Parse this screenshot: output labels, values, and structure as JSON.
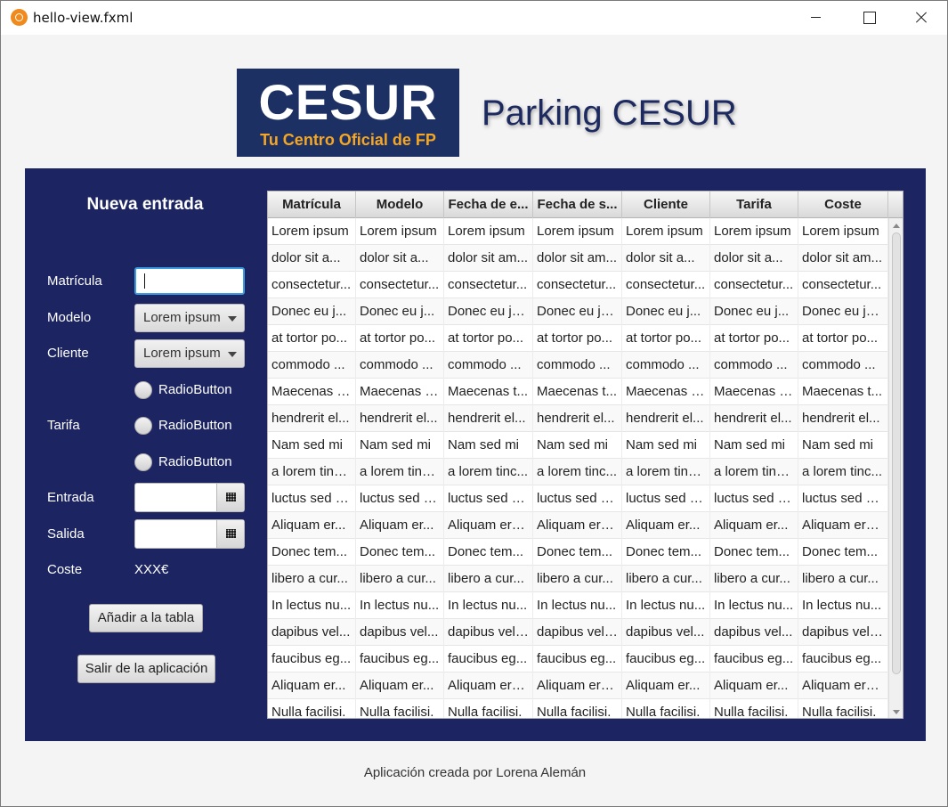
{
  "window": {
    "title": "hello-view.fxml"
  },
  "header": {
    "logo_main": "CESUR",
    "logo_sub": "Tu Centro Oficial de FP",
    "app_title": "Parking CESUR"
  },
  "form": {
    "title": "Nueva entrada",
    "labels": {
      "matricula": "Matrícula",
      "modelo": "Modelo",
      "cliente": "Cliente",
      "tarifa": "Tarifa",
      "entrada": "Entrada",
      "salida": "Salida",
      "coste": "Coste"
    },
    "matricula_value": "",
    "modelo_value": "Lorem ipsum",
    "cliente_value": "Lorem ipsum",
    "radios": [
      "RadioButton",
      "RadioButton",
      "RadioButton"
    ],
    "entrada_value": "",
    "salida_value": "",
    "coste_value": "XXX€",
    "add_button": "Añadir a la tabla",
    "exit_button": "Salir de la aplicación"
  },
  "table": {
    "columns": [
      "Matrícula",
      "Modelo",
      "Fecha de e...",
      "Fecha de s...",
      "Cliente",
      "Tarifa",
      "Coste"
    ],
    "rows": [
      [
        "Lorem ipsum",
        "Lorem ipsum",
        "Lorem ipsum",
        "Lorem ipsum",
        "Lorem ipsum",
        "Lorem ipsum",
        "Lorem ipsum"
      ],
      [
        "dolor sit a...",
        "dolor sit a...",
        "dolor sit am...",
        "dolor sit am...",
        "dolor sit a...",
        "dolor sit a...",
        "dolor sit am..."
      ],
      [
        "consectetur...",
        "consectetur...",
        "consectetur...",
        "consectetur...",
        "consectetur...",
        "consectetur...",
        "consectetur..."
      ],
      [
        "Donec eu j...",
        "Donec eu j...",
        "Donec eu ju...",
        "Donec eu ju...",
        "Donec eu j...",
        "Donec eu j...",
        "Donec eu ju..."
      ],
      [
        "at tortor po...",
        "at tortor po...",
        "at tortor po...",
        "at tortor po...",
        "at tortor po...",
        "at tortor po...",
        "at tortor po..."
      ],
      [
        "commodo ...",
        "commodo ...",
        "commodo ...",
        "commodo ...",
        "commodo ...",
        "commodo ...",
        "commodo ..."
      ],
      [
        "Maecenas t...",
        "Maecenas t...",
        "Maecenas t...",
        "Maecenas t...",
        "Maecenas t...",
        "Maecenas t...",
        "Maecenas t..."
      ],
      [
        "hendrerit el...",
        "hendrerit el...",
        "hendrerit el...",
        "hendrerit el...",
        "hendrerit el...",
        "hendrerit el...",
        "hendrerit el..."
      ],
      [
        "Nam sed mi",
        "Nam sed mi",
        "Nam sed mi",
        "Nam sed mi",
        "Nam sed mi",
        "Nam sed mi",
        "Nam sed mi"
      ],
      [
        "a lorem tinc...",
        "a lorem tinc...",
        "a lorem tinc...",
        "a lorem tinc...",
        "a lorem tinc...",
        "a lorem tinc...",
        "a lorem tinc..."
      ],
      [
        "luctus sed n...",
        "luctus sed n...",
        "luctus sed n...",
        "luctus sed n...",
        "luctus sed n...",
        "luctus sed n...",
        "luctus sed n..."
      ],
      [
        "Aliquam er...",
        "Aliquam er...",
        "Aliquam era...",
        "Aliquam era...",
        "Aliquam er...",
        "Aliquam er...",
        "Aliquam era..."
      ],
      [
        "Donec tem...",
        "Donec tem...",
        "Donec tem...",
        "Donec tem...",
        "Donec tem...",
        "Donec tem...",
        "Donec tem..."
      ],
      [
        "libero a cur...",
        "libero a cur...",
        "libero a cur...",
        "libero a cur...",
        "libero a cur...",
        "libero a cur...",
        "libero a cur..."
      ],
      [
        "In lectus nu...",
        "In lectus nu...",
        "In lectus nu...",
        "In lectus nu...",
        "In lectus nu...",
        "In lectus nu...",
        "In lectus nu..."
      ],
      [
        "dapibus vel...",
        "dapibus vel...",
        "dapibus vel ...",
        "dapibus vel ...",
        "dapibus vel...",
        "dapibus vel...",
        "dapibus vel ..."
      ],
      [
        "faucibus eg...",
        "faucibus eg...",
        "faucibus eg...",
        "faucibus eg...",
        "faucibus eg...",
        "faucibus eg...",
        "faucibus eg..."
      ],
      [
        "Aliquam er...",
        "Aliquam er...",
        "Aliquam era...",
        "Aliquam era...",
        "Aliquam er...",
        "Aliquam er...",
        "Aliquam era..."
      ],
      [
        "Nulla facilisi.",
        "Nulla facilisi.",
        "Nulla facilisi.",
        "Nulla facilisi.",
        "Nulla facilisi.",
        "Nulla facilisi.",
        "Nulla facilisi."
      ]
    ]
  },
  "footer": {
    "text": "Aplicación creada por Lorena Alemán"
  },
  "colors": {
    "panel": "#1c2562",
    "logo_bg": "#1d3063",
    "logo_accent": "#f5a623",
    "title": "#1d2a60",
    "focus": "#3d9be0"
  },
  "icons": [
    "app-icon",
    "minimize-icon",
    "maximize-icon",
    "close-icon",
    "chevron-down-icon",
    "calendar-icon"
  ]
}
